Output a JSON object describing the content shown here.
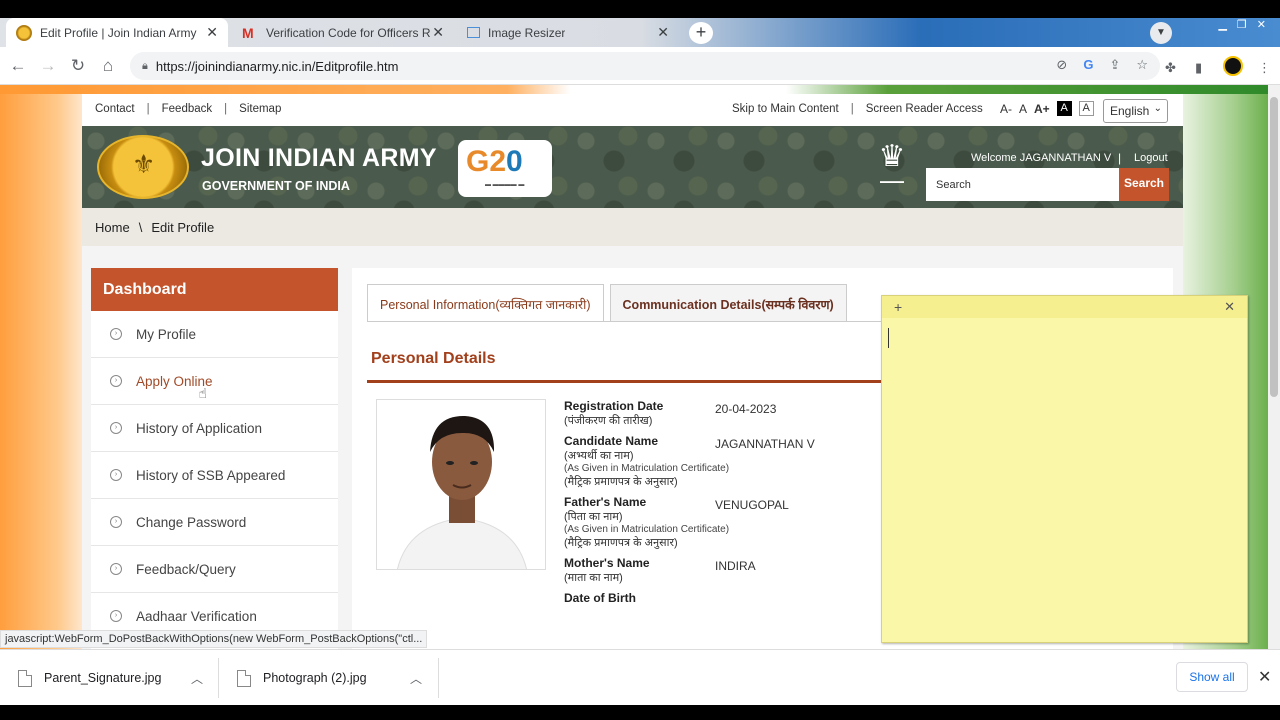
{
  "browser": {
    "tabs": [
      {
        "title": "Edit Profile | Join Indian Army",
        "active": true
      },
      {
        "title": "Verification Code for Officers Reg",
        "active": false
      },
      {
        "title": "Image Resizer",
        "active": false
      }
    ],
    "url": "https://joinindianarmy.nic.in/Editprofile.htm"
  },
  "util": {
    "contact": "Contact",
    "feedback": "Feedback",
    "sitemap": "Sitemap",
    "skip": "Skip to Main Content",
    "screen_reader": "Screen Reader Access",
    "font_minus": "A-",
    "font_normal": "A",
    "font_plus": "A+",
    "contrast_dark": "A",
    "contrast_light": "A",
    "language": "English",
    "sep": "|"
  },
  "banner": {
    "title": "JOIN INDIAN ARMY",
    "subtitle": "GOVERNMENT OF INDIA",
    "welcome": "Welcome JAGANNATHAN V",
    "logout": "Logout",
    "search_placeholder": "Search",
    "search_button": "Search"
  },
  "breadcrumb": {
    "home": "Home",
    "sep": "\\",
    "current": "Edit Profile"
  },
  "dashboard": {
    "title": "Dashboard",
    "items": [
      "My Profile",
      "Apply Online",
      "History of Application",
      "History of SSB Appeared",
      "Change Password",
      "Feedback/Query",
      "Aadhaar Verification"
    ]
  },
  "main": {
    "tab_personal": "Personal Information(व्यक्तिगत जानकारी)",
    "tab_comm": "Communication Details(सम्पर्क विवरण)",
    "section_title": "Personal Details",
    "fields": [
      {
        "label": "Registration Date",
        "hindi": "(पंजीकरण की तारीख)",
        "sub1": "",
        "sub2": "",
        "value": "20-04-2023"
      },
      {
        "label": "Candidate Name",
        "hindi": "(अभ्‍यर्थी का नाम)",
        "sub1": "(As Given in Matriculation Certificate)",
        "sub2": "(मैट्रिक प्रमाणपत्र के अनुसार)",
        "value": "JAGANNATHAN V"
      },
      {
        "label": "Father's Name",
        "hindi": "(पिता का नाम)",
        "sub1": "(As Given in Matriculation Certificate)",
        "sub2": "(मैट्रिक प्रमाणपत्र के अनुसार)",
        "value": "VENUGOPAL"
      },
      {
        "label": "Mother's Name",
        "hindi": "(माता का नाम)",
        "sub1": "",
        "sub2": "",
        "value": "INDIRA"
      },
      {
        "label": "Date of Birth",
        "hindi": "",
        "sub1": "",
        "sub2": "",
        "value": ""
      }
    ]
  },
  "status_url": "javascript:WebForm_DoPostBackWithOptions(new WebForm_PostBackOptions(\"ctl...",
  "downloads": {
    "items": [
      "Parent_Signature.jpg",
      "Photograph (2).jpg"
    ],
    "show_all": "Show all"
  }
}
